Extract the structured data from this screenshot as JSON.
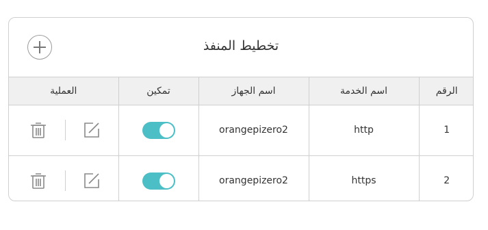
{
  "header": {
    "title": "تخطيط المنفذ",
    "add_icon": "plus-icon"
  },
  "columns": {
    "operation": "العملية",
    "enable": "تمكين",
    "device": "اسم الجهاز",
    "service": "اسم الخدمة",
    "number": "الرقم"
  },
  "rows": [
    {
      "number": "1",
      "service": "http",
      "device": "orangepizero2",
      "enabled": true
    },
    {
      "number": "2",
      "service": "https",
      "device": "orangepizero2",
      "enabled": true
    }
  ],
  "colors": {
    "toggle_on": "#4bbfc5",
    "border": "#cfcfcf",
    "header_bg": "#f0f0f0"
  }
}
